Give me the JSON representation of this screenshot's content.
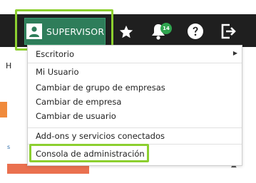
{
  "header": {
    "user_label": "SUPERVISOR",
    "notification_count": "14",
    "icons": [
      "user-icon",
      "star-icon",
      "bell-icon",
      "help-icon",
      "logout-icon"
    ],
    "colors": {
      "bar": "#1f1f1f",
      "user_button": "#2e7d5a",
      "badge": "#2fa44f",
      "highlight": "#8ccf2f"
    }
  },
  "background_page": {
    "heading_fragment": "H",
    "link_fragment": "s"
  },
  "menu": {
    "escritorio": "Escritorio",
    "mi_usuario": "Mi Usuario",
    "cambiar_grupo": "Cambiar de grupo de empresas",
    "cambiar_empresa": "Cambiar de empresa",
    "cambiar_usuario": "Cambiar de usuario",
    "addons": "Add-ons y servicios conectados",
    "consola": "Consola de administración"
  }
}
